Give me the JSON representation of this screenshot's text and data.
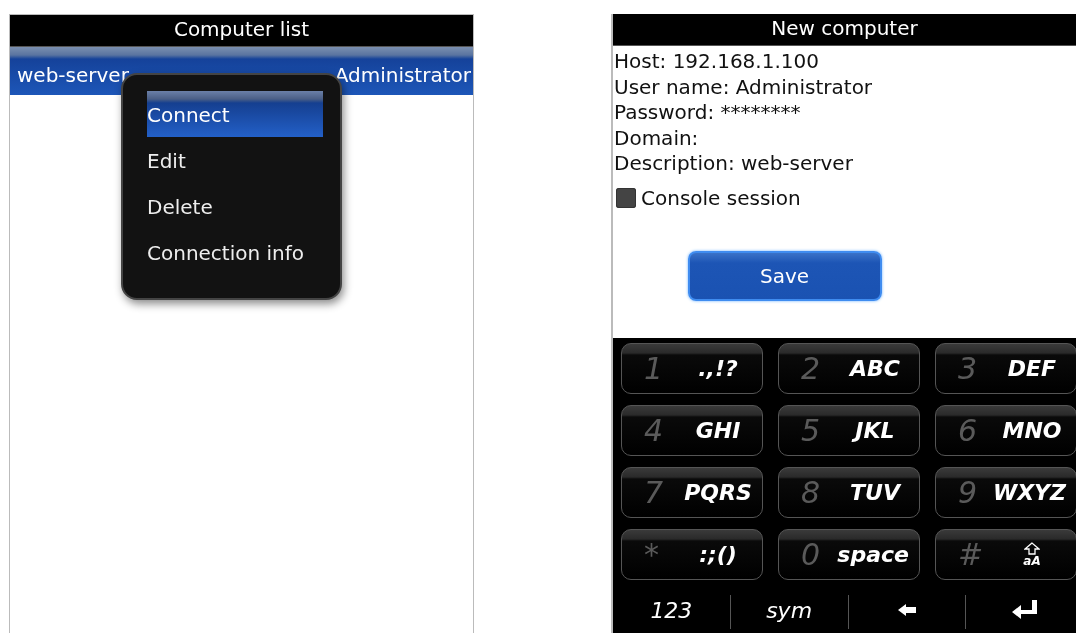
{
  "list_screen": {
    "title": "Computer list",
    "rows": [
      {
        "text_parts": [
          "web-server",
          "Administrator"
        ],
        "selected": true
      }
    ],
    "context_menu": [
      {
        "label": "Connect",
        "selected": true
      },
      {
        "label": "Edit",
        "selected": false
      },
      {
        "label": "Delete",
        "selected": false
      },
      {
        "label": "Connection info",
        "selected": false
      }
    ]
  },
  "form_screen": {
    "title": "New computer",
    "fields": [
      {
        "label": "Host:",
        "value": "192.168.1.100"
      },
      {
        "label": "User name:",
        "value": "Administrator"
      },
      {
        "label": "Password:",
        "value": "********"
      },
      {
        "label": "Domain:"
      },
      {
        "label": "Description:",
        "value": "web-server"
      }
    ],
    "console_session": {
      "label": "Console session",
      "checked": false
    },
    "save_button": "Save"
  },
  "keyboard": {
    "rows": [
      [
        {
          "kind": "key",
          "digit": "1",
          "letters": ".,!?"
        },
        {
          "kind": "key",
          "digit": "2",
          "letters": "ABC"
        },
        {
          "kind": "key",
          "digit": "3",
          "letters": "DEF"
        }
      ],
      [
        {
          "kind": "key",
          "digit": "4",
          "letters": "GHI"
        },
        {
          "kind": "key",
          "digit": "5",
          "letters": "JKL"
        },
        {
          "kind": "key",
          "digit": "6",
          "letters": "MNO"
        }
      ],
      [
        {
          "kind": "key",
          "digit": "7",
          "letters": "PQRS"
        },
        {
          "kind": "key",
          "digit": "8",
          "letters": "TUV"
        },
        {
          "kind": "key",
          "digit": "9",
          "letters": "WXYZ"
        }
      ],
      [
        {
          "kind": "key",
          "digit": "*",
          "letters": ":;()"
        },
        {
          "kind": "key",
          "digit": "0",
          "letters": "space"
        },
        {
          "kind": "shift",
          "digit": "#",
          "letters": "aA"
        }
      ]
    ],
    "bottom_row": [
      {
        "kind": "text",
        "label": "123"
      },
      {
        "kind": "text",
        "label": "sym"
      },
      {
        "kind": "backspace"
      },
      {
        "kind": "enter"
      }
    ]
  }
}
